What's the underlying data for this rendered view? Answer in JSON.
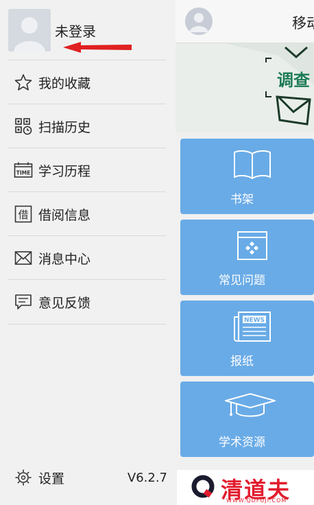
{
  "drawer": {
    "login_label": "未登录",
    "menu": [
      {
        "label": "我的收藏",
        "icon": "star-icon"
      },
      {
        "label": "扫描历史",
        "icon": "qr-scan-history-icon"
      },
      {
        "label": "学习历程",
        "icon": "time-calendar-icon"
      },
      {
        "label": "借阅信息",
        "icon": "borrow-icon"
      },
      {
        "label": "消息中心",
        "icon": "envelope-icon"
      },
      {
        "label": "意见反馈",
        "icon": "feedback-icon"
      }
    ],
    "settings_label": "设置",
    "version": "V6.2.7"
  },
  "main": {
    "title": "移动",
    "banner_text": "调查",
    "tiles": [
      {
        "label": "书架",
        "icon": "book-icon"
      },
      {
        "label": "常见问题",
        "icon": "faq-window-icon"
      },
      {
        "label": "报纸",
        "icon": "newspaper-icon"
      },
      {
        "label": "学术资源",
        "icon": "graduation-cap-icon"
      }
    ],
    "newspaper_icon_text": "NEWS",
    "calendar_icon_text": "TIME"
  },
  "watermark": {
    "text": "清道夫",
    "sub": "WWW.QDFUJI.COM"
  },
  "colors": {
    "tile_blue": "#69abe7",
    "arrow_red": "#e02020",
    "banner_green": "#1c7b55"
  }
}
